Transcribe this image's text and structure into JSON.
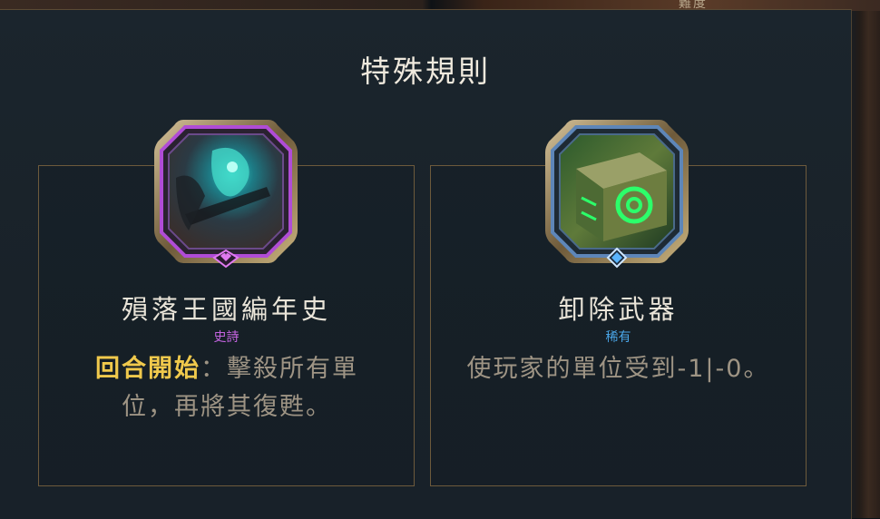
{
  "background": {
    "top_right_text": "難度"
  },
  "panel": {
    "title": "特殊規則",
    "cards": [
      {
        "name": "殞落王國編年史",
        "rarity": "史詩",
        "rarity_color": "#c464e0",
        "icon": "shadow-knight-portrait-icon",
        "gem_icon": "purple-heart-gem-icon",
        "description_highlight": "回合開始",
        "description_line1_rest": "：擊殺所有單",
        "description_line2": "位，再將其復甦。"
      },
      {
        "name": "卸除武器",
        "rarity": "稀有",
        "rarity_color": "#4aa6e8",
        "icon": "green-rune-crate-icon",
        "gem_icon": "blue-diamond-gem-icon",
        "description": "使玩家的單位受到-1|-0。"
      }
    ]
  },
  "colors": {
    "panel_bg": "#1a242b",
    "border_gold": "#6d5a3c",
    "highlight_yellow": "#f0c94c",
    "text_muted": "#9e9484"
  }
}
